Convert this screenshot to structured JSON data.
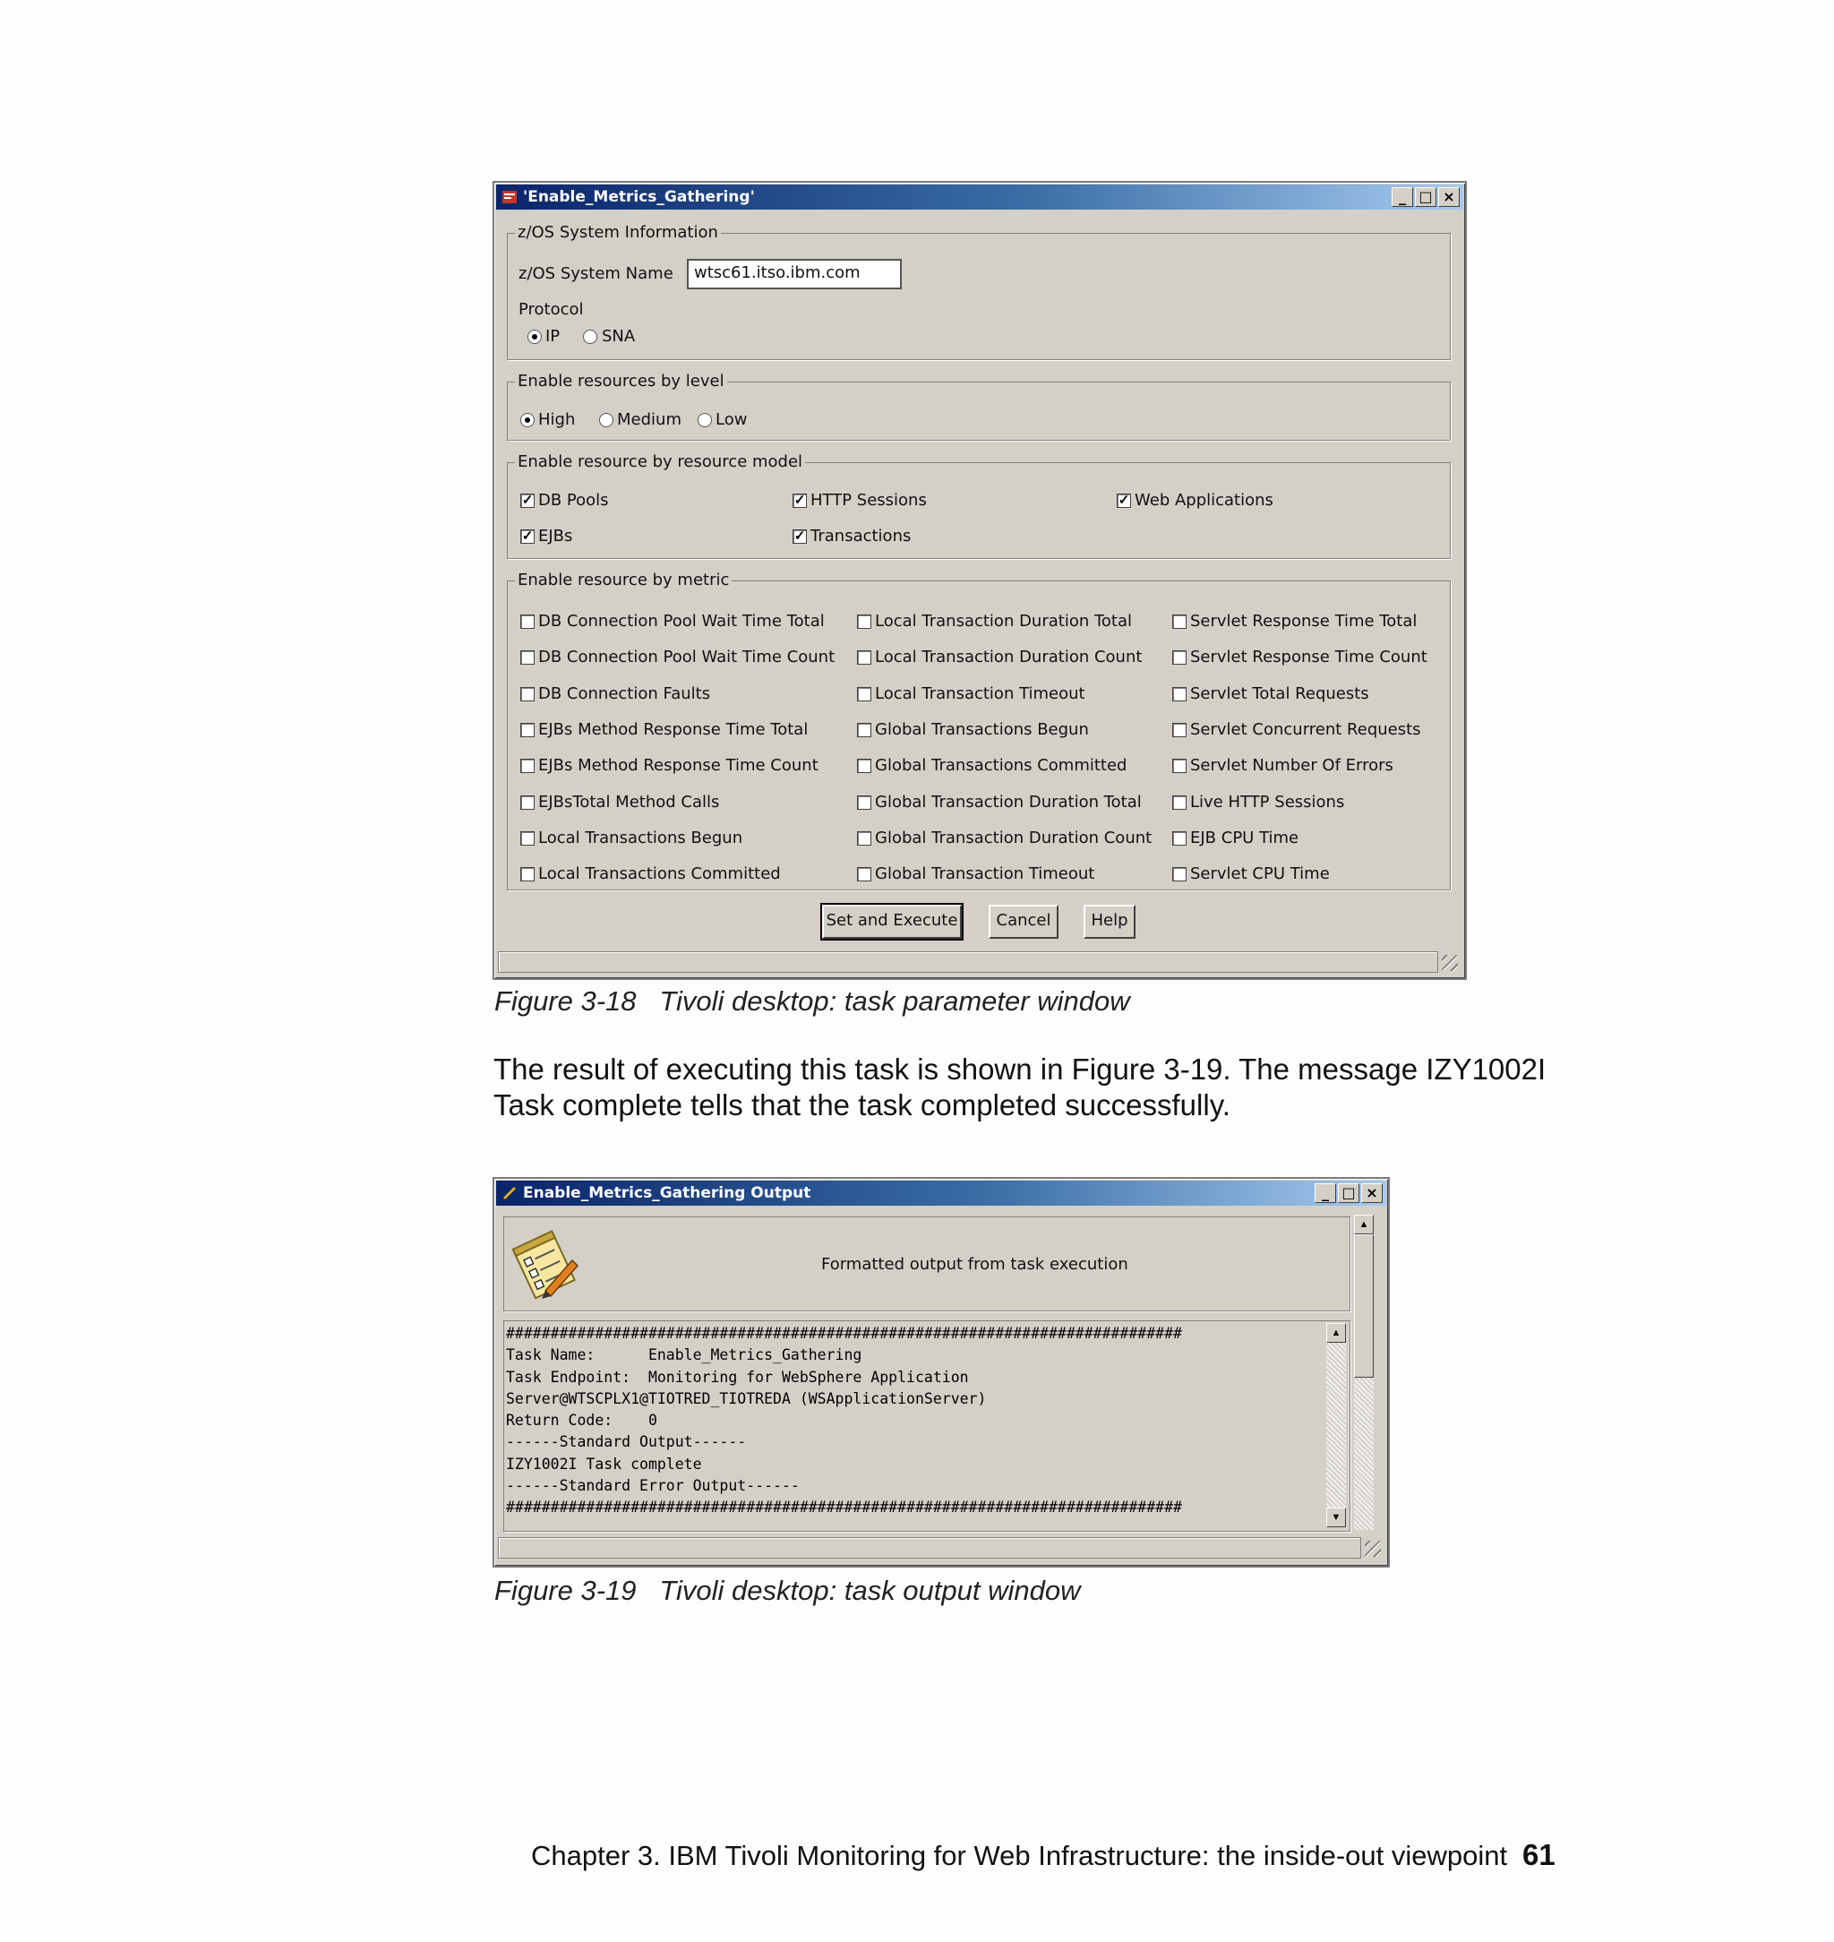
{
  "window1": {
    "title": "'Enable_Metrics_Gathering'",
    "sys_group_label": "z/OS System Information",
    "sys_name_label": "z/OS System Name",
    "sys_name_value": "wtsc61.itso.ibm.com",
    "protocol_label": "Protocol",
    "protocol_options": [
      "IP",
      "SNA"
    ],
    "protocol_selected": "IP",
    "level_group_label": "Enable resources by level",
    "level_options": [
      "High",
      "Medium",
      "Low"
    ],
    "level_selected": "High",
    "model_group_label": "Enable resource by resource model",
    "model_items": [
      {
        "label": "DB Pools",
        "checked": true
      },
      {
        "label": "HTTP Sessions",
        "checked": true
      },
      {
        "label": "Web Applications",
        "checked": true
      },
      {
        "label": "EJBs",
        "checked": true
      },
      {
        "label": "Transactions",
        "checked": true
      }
    ],
    "metric_group_label": "Enable resource by metric",
    "metrics_col1": [
      "DB Connection Pool Wait Time Total",
      "DB Connection Pool Wait Time Count",
      "DB Connection Faults",
      "EJBs Method Response Time Total",
      "EJBs Method Response Time Count",
      "EJBsTotal Method Calls",
      "Local Transactions Begun",
      "Local Transactions Committed"
    ],
    "metrics_col2": [
      "Local Transaction Duration Total",
      "Local Transaction Duration Count",
      "Local Transaction Timeout",
      "Global Transactions Begun",
      "Global Transactions Committed",
      "Global Transaction Duration Total",
      "Global Transaction Duration Count",
      "Global Transaction Timeout"
    ],
    "metrics_col3": [
      "Servlet Response Time Total",
      "Servlet Response Time Count",
      "Servlet Total Requests",
      "Servlet Concurrent Requests",
      "Servlet Number Of Errors",
      "Live HTTP Sessions",
      "EJB CPU Time",
      "Servlet CPU Time"
    ],
    "buttons": {
      "execute": "Set and Execute",
      "cancel": "Cancel",
      "help": "Help"
    }
  },
  "caption1": "Figure 3-18   Tivoli desktop: task parameter window",
  "paragraph_line1": "The result of executing this task is shown in Figure 3-19. The message IZY1002I",
  "paragraph_line2": "Task complete tells that the task completed successfully.",
  "window2": {
    "title": "Enable_Metrics_Gathering Output",
    "header_text": "Formatted output from task execution",
    "output_lines": [
      "############################################################################",
      "Task Name:      Enable_Metrics_Gathering",
      "Task Endpoint:  Monitoring for WebSphere Application",
      "Server@WTSCPLX1@TIOTRED_TIOTREDA (WSApplicationServer)",
      "Return Code:    0",
      "------Standard Output------",
      "IZY1002I Task complete",
      "------Standard Error Output------",
      "############################################################################"
    ]
  },
  "caption2": "Figure 3-19   Tivoli desktop: task output window",
  "footer": {
    "chapter": "Chapter 3. IBM Tivoli Monitoring for Web Infrastructure: the inside-out viewpoint",
    "page_number": "61"
  }
}
